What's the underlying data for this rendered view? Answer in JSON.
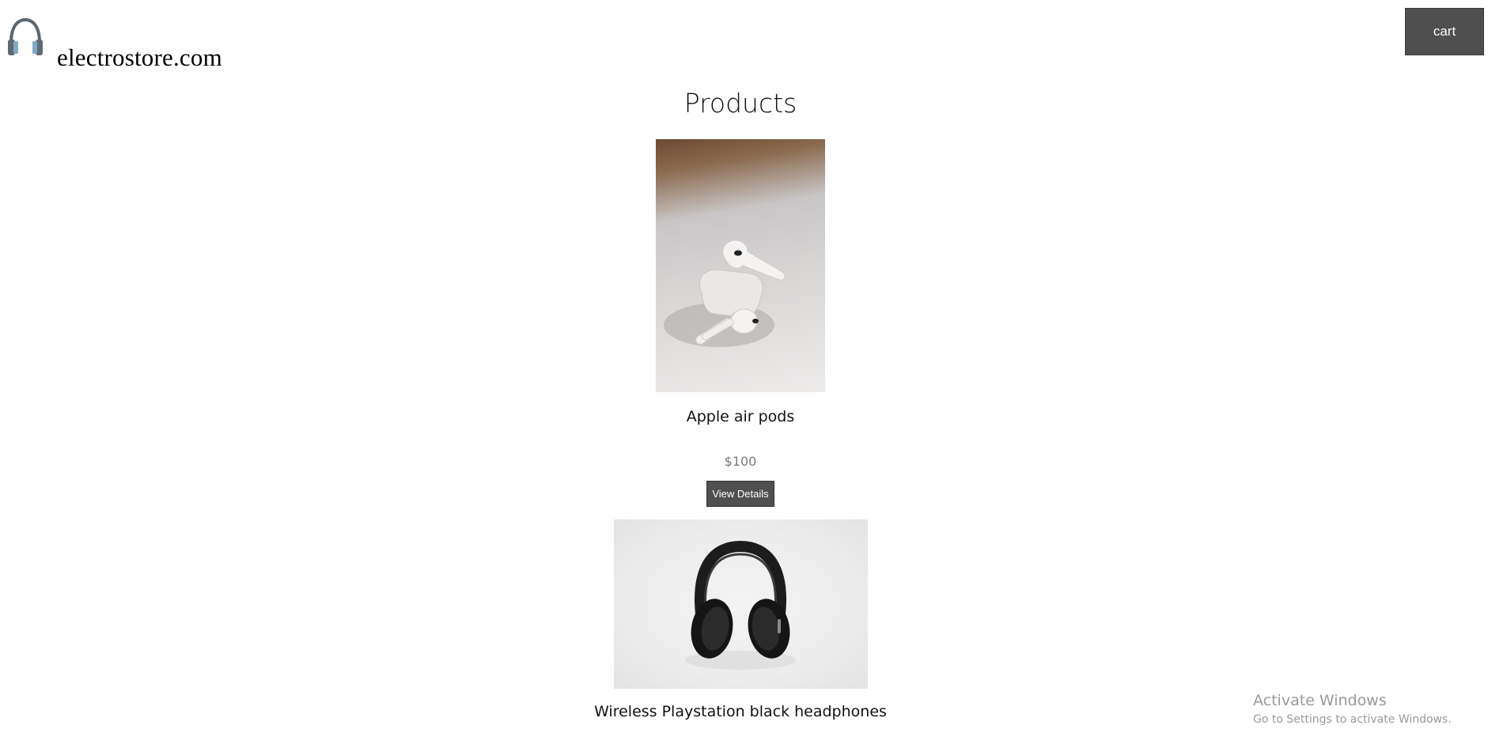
{
  "header": {
    "site_name": "electrostore.com",
    "logo_icon": "headphones-icon",
    "cart_label": "cart"
  },
  "main": {
    "title": "Products",
    "products": [
      {
        "name": "Apple air pods",
        "price": "$100",
        "details_label": "View Details",
        "image": "airpods-photo"
      },
      {
        "name": "Wireless Playstation black headphones",
        "image": "headphones-photo"
      }
    ]
  },
  "watermark": {
    "title": "Activate Windows",
    "subtitle": "Go to Settings to activate Windows."
  },
  "colors": {
    "button_bg": "#4f4f4f",
    "button_text": "#ffffff",
    "price_text": "#7a7a7a"
  }
}
